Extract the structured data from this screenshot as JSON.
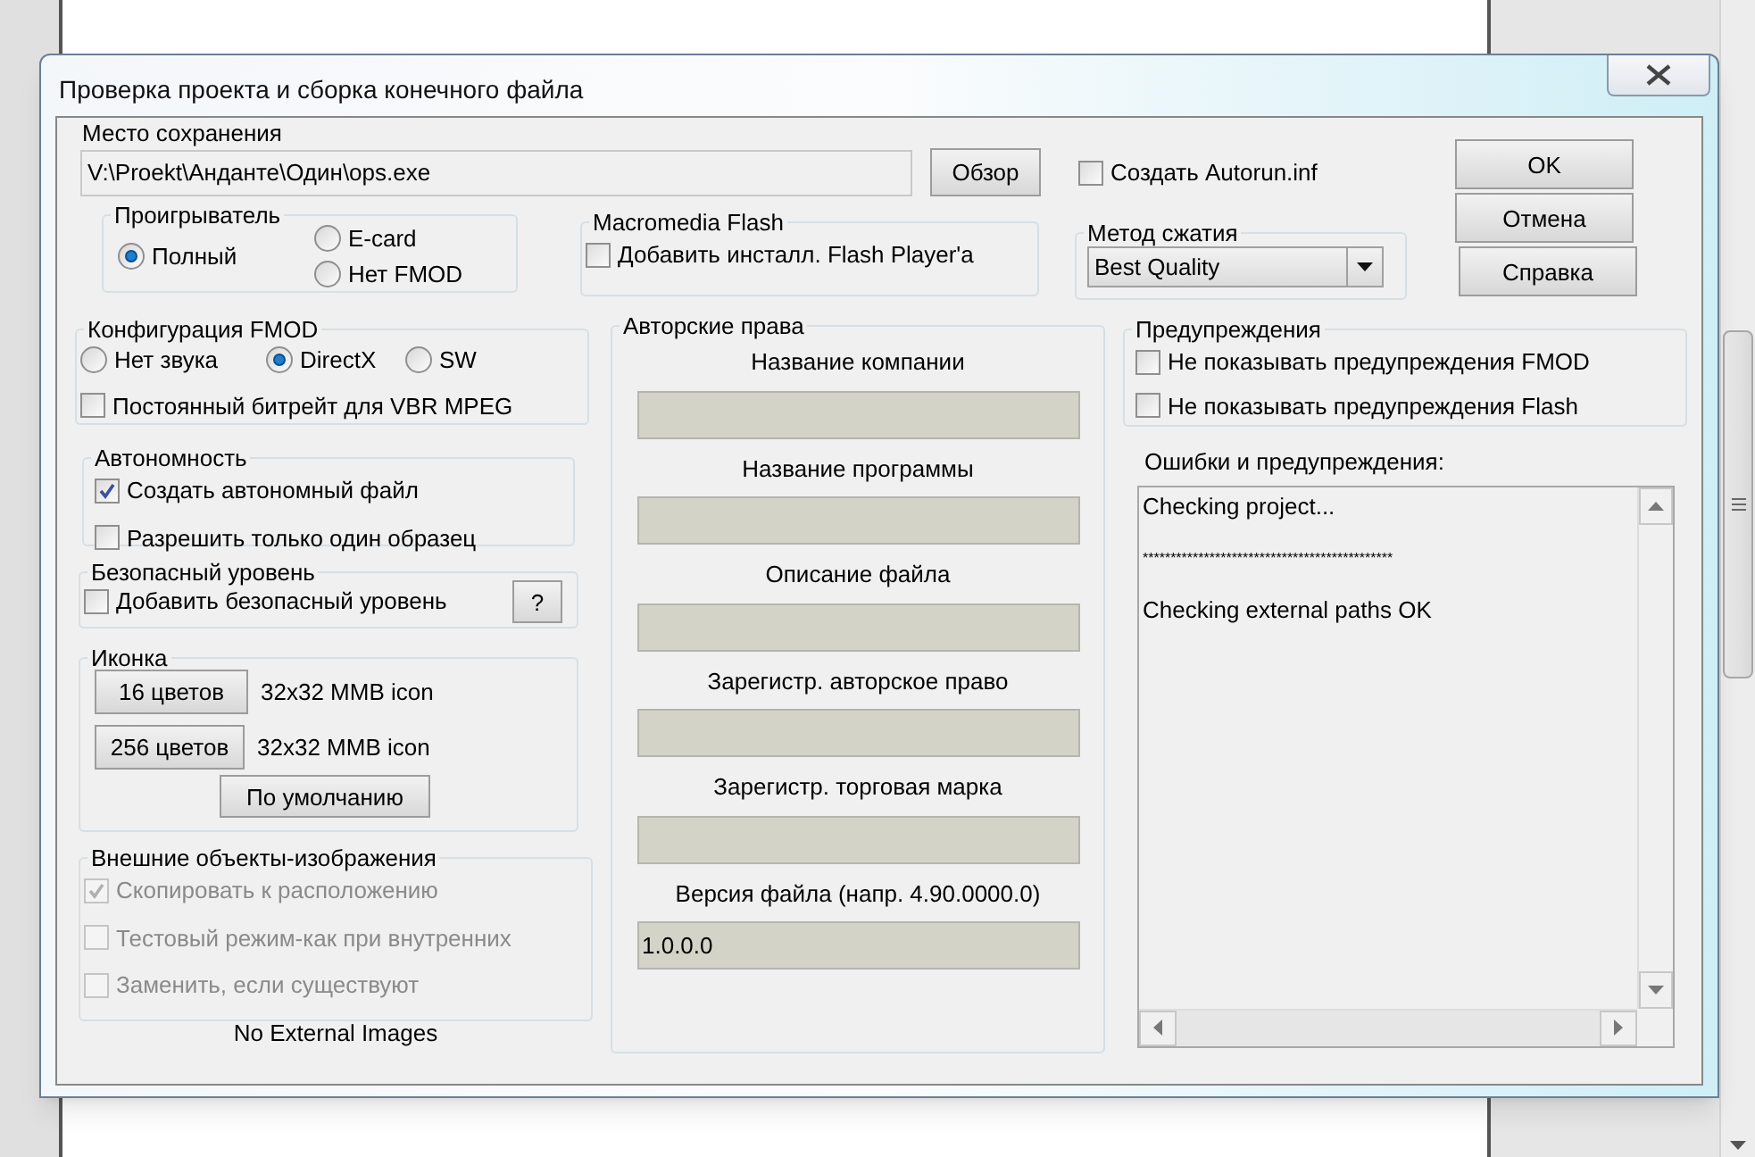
{
  "window": {
    "title": "Проверка проекта и сборка конечного файла"
  },
  "save_location": {
    "label": "Место сохранения",
    "value": "V:\\Proekt\\Анданте\\Один\\ops.exe",
    "browse_button": "Обзор"
  },
  "autorun": {
    "label": "Создать Autorun.inf",
    "checked": false
  },
  "buttons": [
    "OK",
    "Отмена",
    "Справка"
  ],
  "player": {
    "title": "Проигрыватель",
    "options": [
      {
        "label": "Полный",
        "selected": true
      },
      {
        "label": "E-card",
        "selected": false
      },
      {
        "label": "Нет FMOD",
        "selected": false
      }
    ]
  },
  "flash": {
    "title": "Macromedia Flash",
    "checkbox": {
      "label": "Добавить инсталл. Flash Player'a",
      "checked": false
    }
  },
  "compression": {
    "title": "Метод сжатия",
    "value": "Best Quality"
  },
  "fmod": {
    "title": "Конфигурация FMOD",
    "options": [
      {
        "label": "Нет звука",
        "selected": false
      },
      {
        "label": "DirectX",
        "selected": true
      },
      {
        "label": "SW",
        "selected": false
      }
    ],
    "checkbox": {
      "label": "Постоянный битрейт для VBR MPEG",
      "checked": false
    }
  },
  "autonomy": {
    "title": "Автономность",
    "checkboxes": [
      {
        "label": "Создать автономный файл",
        "checked": true
      },
      {
        "label": "Разрешить только один образец",
        "checked": false
      }
    ]
  },
  "security": {
    "title": "Безопасный уровень",
    "checkbox": {
      "label": "Добавить безопасный уровень",
      "checked": false
    },
    "help_button": "?"
  },
  "icon": {
    "title": "Иконка",
    "rows": [
      {
        "button": "16 цветов",
        "info": "32x32 MMB icon"
      },
      {
        "button": "256 цветов",
        "info": "32x32 MMB icon"
      }
    ],
    "default_button": "По умолчанию"
  },
  "external_images": {
    "title": "Внешние объекты-изображения",
    "checkboxes": [
      {
        "label": "Скопировать к расположению",
        "checked": true,
        "disabled": true
      },
      {
        "label": "Тестовый режим-как при внутренних",
        "checked": false,
        "disabled": true
      },
      {
        "label": "Заменить, если существуют",
        "checked": false,
        "disabled": true
      }
    ],
    "status": "No External Images"
  },
  "copyright": {
    "title": "Авторские права",
    "fields": [
      {
        "label": "Название компании"
      },
      {
        "label": "Название программы"
      },
      {
        "label": "Описание файла"
      },
      {
        "label": "Зарегистр. авторское право"
      },
      {
        "label": "Зарегистр. торговая марка"
      },
      {
        "label": "Версия файла (напр. 4.90.0000.0)",
        "value": "1.0.0.0"
      }
    ]
  },
  "warnings": {
    "title": "Предупреждения",
    "checkboxes": [
      {
        "label": "Не показывать предупреждения FMOD",
        "checked": false
      },
      {
        "label": "Не показывать предупреждения Flash",
        "checked": false
      }
    ]
  },
  "log": {
    "label": "Ошибки и предупреждения:",
    "lines": [
      {
        "text": "Checking project...",
        "blank_before": false
      },
      {
        "text": "*********************************************",
        "blank_before": true
      },
      {
        "text": "Checking external paths OK",
        "blank_before": true
      }
    ]
  }
}
